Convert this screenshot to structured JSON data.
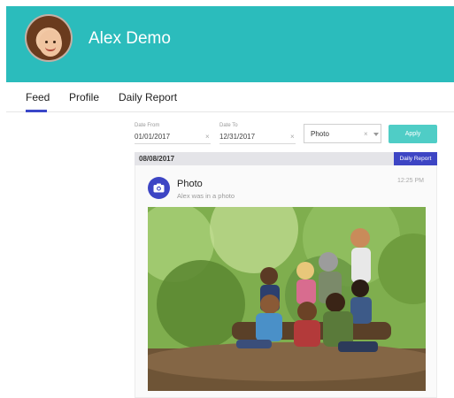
{
  "header": {
    "user_name": "Alex Demo"
  },
  "tabs": [
    {
      "label": "Feed",
      "active": true
    },
    {
      "label": "Profile",
      "active": false
    },
    {
      "label": "Daily Report",
      "active": false
    }
  ],
  "filters": {
    "date_from": {
      "label": "Date From",
      "value": "01/01/2017"
    },
    "date_to": {
      "label": "Date To",
      "value": "12/31/2017"
    },
    "type": {
      "value": "Photo"
    },
    "apply_label": "Apply"
  },
  "feed": {
    "date": "08/08/2017",
    "daily_report_label": "Daily Report",
    "post": {
      "icon": "camera-icon",
      "title": "Photo",
      "subtitle": "Alex was in a photo",
      "time": "12:25 PM"
    }
  },
  "colors": {
    "header_bg": "#2bbcbc",
    "accent": "#3d45c4",
    "apply_bg": "#4fcdc6"
  }
}
